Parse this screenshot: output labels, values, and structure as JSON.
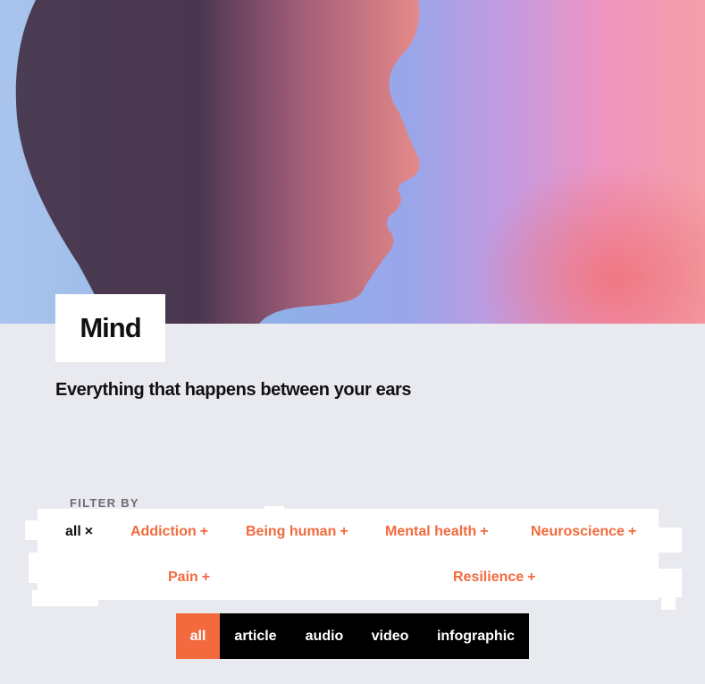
{
  "page": {
    "title": "Mind",
    "subtitle": "Everything that happens between your ears"
  },
  "hero": {
    "image": "head-profile-silhouette-illustration"
  },
  "filters": {
    "label": "FILTER BY",
    "tags": [
      {
        "label": "all",
        "mark": "×",
        "active": true
      },
      {
        "label": "Addiction",
        "mark": "+"
      },
      {
        "label": "Being human",
        "mark": "+"
      },
      {
        "label": "Mental health",
        "mark": "+"
      },
      {
        "label": "Neuroscience",
        "mark": "+"
      },
      {
        "label": "Pain",
        "mark": "+"
      },
      {
        "label": "Resilience",
        "mark": "+"
      }
    ]
  },
  "formats": [
    {
      "label": "all",
      "active": true
    },
    {
      "label": "article"
    },
    {
      "label": "audio"
    },
    {
      "label": "video"
    },
    {
      "label": "infographic"
    }
  ],
  "colors": {
    "accent": "#f26a3d",
    "background": "#e9eaef",
    "text": "#111111",
    "muted": "#6d6d73"
  }
}
